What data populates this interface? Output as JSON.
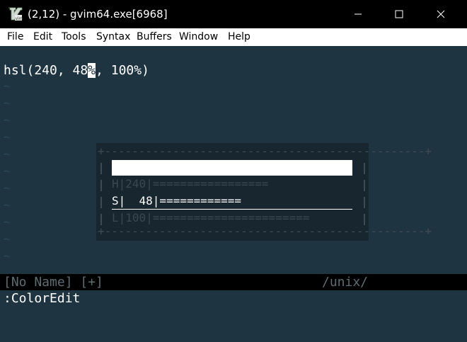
{
  "window": {
    "title": "(2,12) - gvim64.exe[6968]",
    "app_icon": "vim-logo-icon",
    "controls": [
      "minimize-icon",
      "maximize-icon",
      "close-icon"
    ]
  },
  "menu": {
    "file": "File",
    "edit": "Edit",
    "tools": "Tools",
    "syntax": "Syntax",
    "buffers": "Buffers",
    "window": "Window",
    "help": "Help"
  },
  "editor": {
    "line_before_cursor": "hsl(240, 48",
    "cursor_char": "%",
    "line_after_cursor": ", 100%)",
    "tilde": "~",
    "background": "#1f3441",
    "tilde_color": "#2a4a55"
  },
  "popup": {
    "border_top": "+-----------------------------------------------+",
    "border_bottom": "+-----------------------------------------------+",
    "preview_color": "#ffffff",
    "rows": {
      "h": "H|240|=================",
      "s": "S|  48|============",
      "l": "L|100|======================="
    }
  },
  "status": {
    "buffer": "[No Name] [+]",
    "fileformat": "/unix/"
  },
  "cmdline": {
    "text": ":ColorEdit"
  }
}
